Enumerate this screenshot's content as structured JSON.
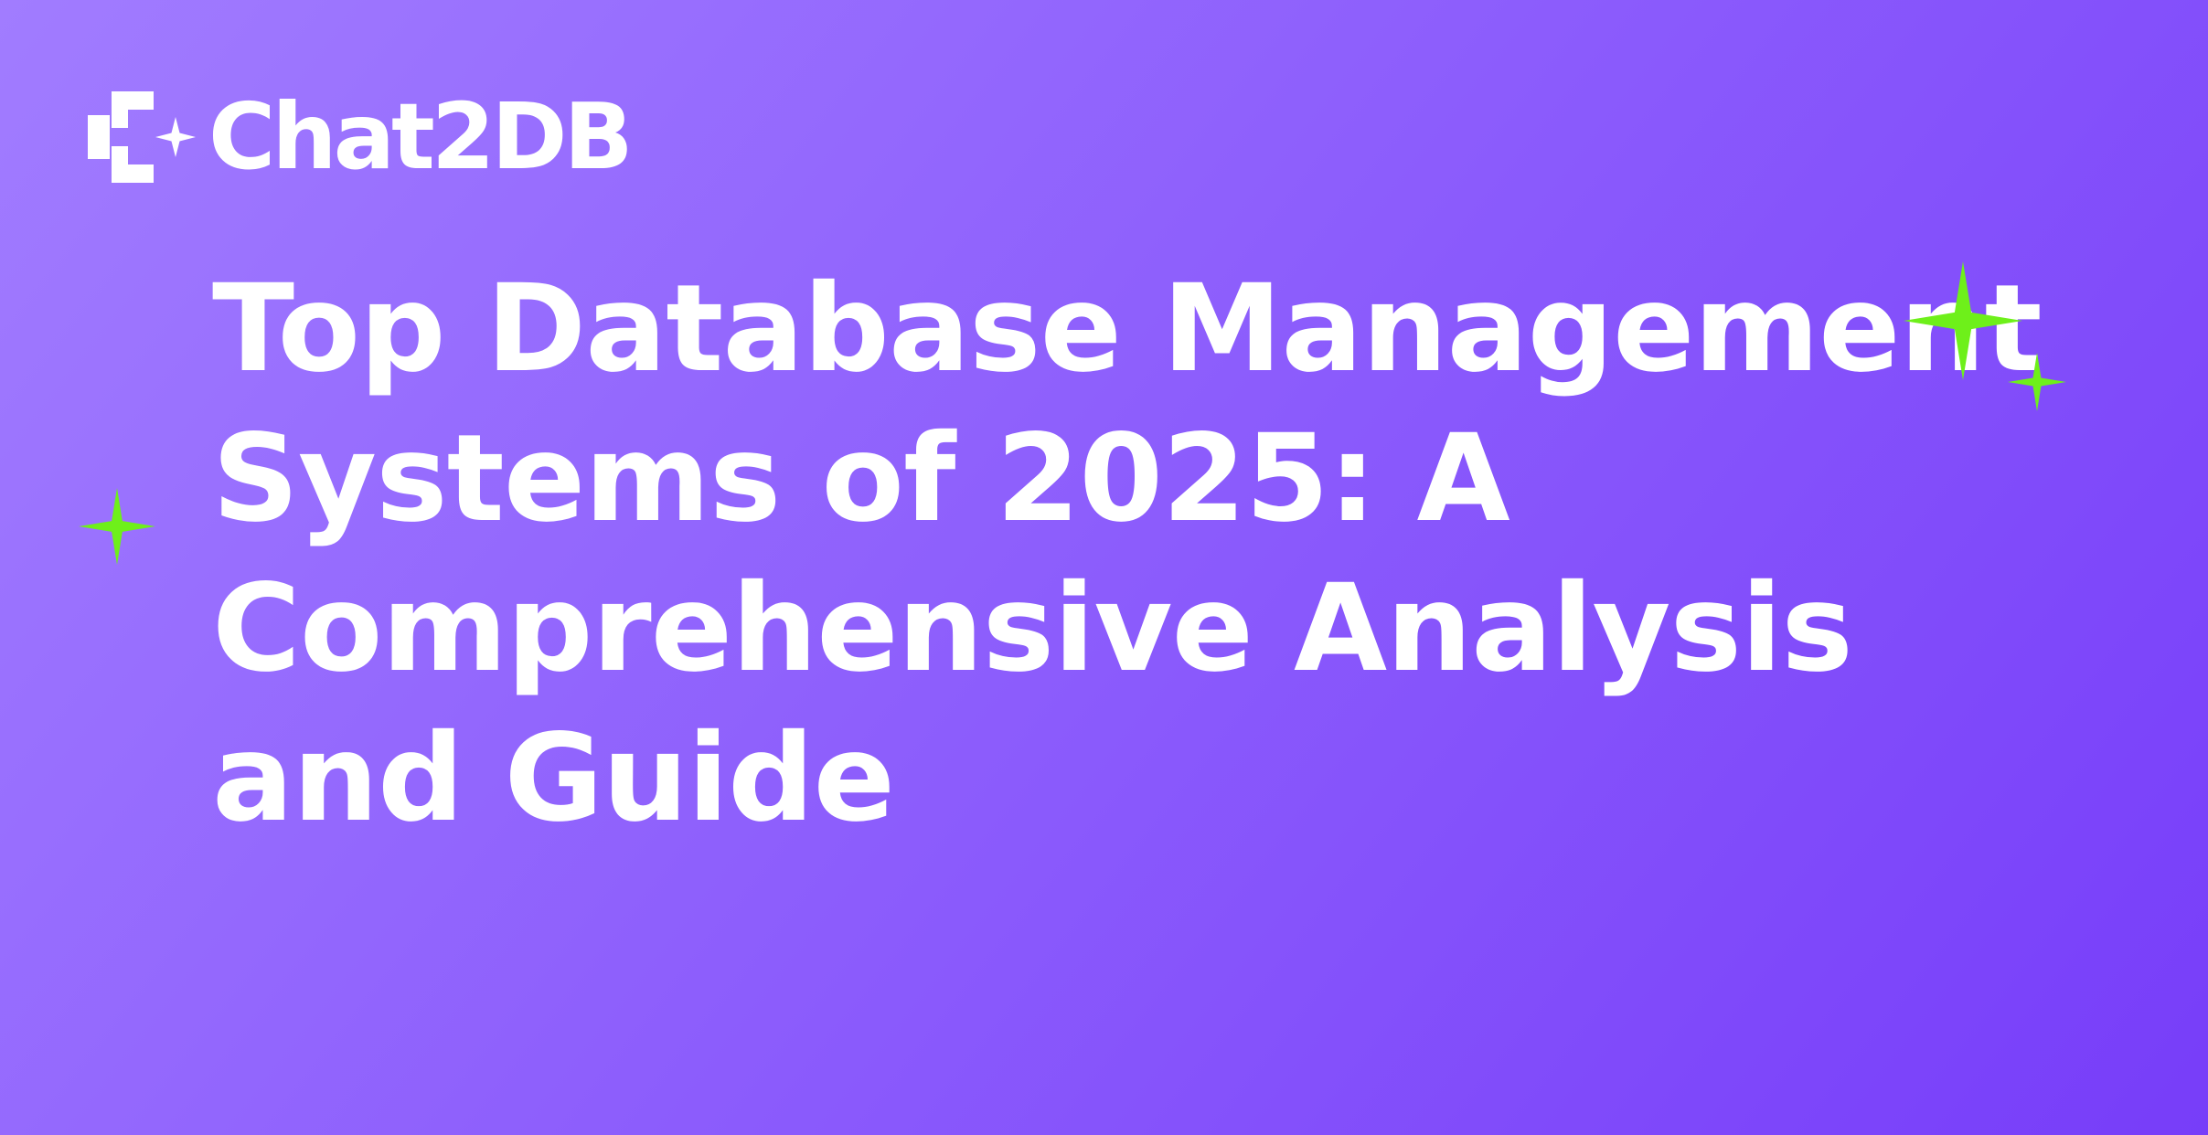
{
  "brand": {
    "name": "Chat2DB"
  },
  "headline": {
    "lines": [
      "Top Database Management",
      "Systems of 2025: A",
      "Comprehensive Analysis",
      "and Guide"
    ]
  },
  "decorations": {
    "logo_icon": "chat2db-logo-icon",
    "sparkle_icon": "four-point-sparkle-icon"
  },
  "colors": {
    "background_start": "#a17cff",
    "background_end": "#773df9",
    "text": "#ffffff",
    "sparkle_accent": "#6ef01a"
  }
}
